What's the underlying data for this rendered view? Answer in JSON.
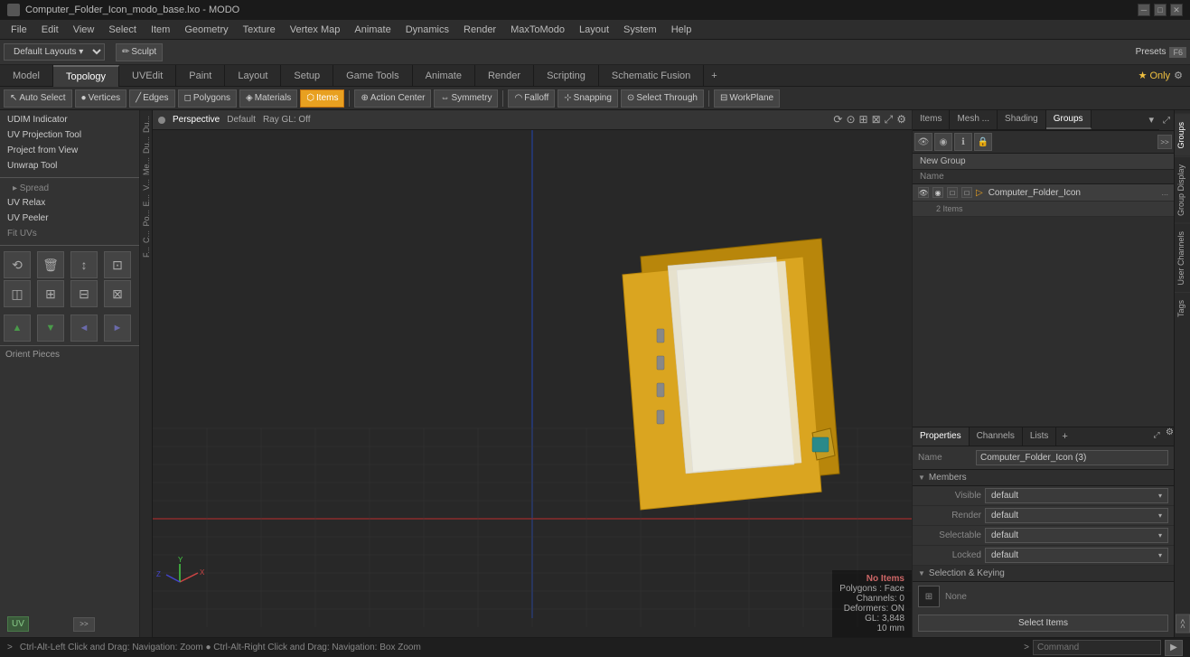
{
  "titlebar": {
    "title": "Computer_Folder_Icon_modo_base.lxo - MODO",
    "icon": "modo-icon",
    "controls": [
      "minimize",
      "maximize",
      "close"
    ]
  },
  "menubar": {
    "items": [
      "File",
      "Edit",
      "View",
      "Select",
      "Item",
      "Geometry",
      "Texture",
      "Vertex Map",
      "Animate",
      "Dynamics",
      "Render",
      "MaxToModo",
      "Layout",
      "System",
      "Help"
    ]
  },
  "toolbar_strip": {
    "default_layouts": "Default Layouts ▾",
    "presets_label": "Presets",
    "presets_key": "F6",
    "sculpt_label": "Sculpt"
  },
  "mode_tabs": {
    "tabs": [
      "Model",
      "Topology",
      "UVEdit",
      "Paint",
      "Layout",
      "Setup",
      "Game Tools",
      "Animate",
      "Render",
      "Scripting",
      "Schematic Fusion"
    ],
    "active": "Topology",
    "add_label": "+",
    "star_only": "★ Only",
    "gear": "⚙"
  },
  "tool_bar": {
    "auto_select": "Auto Select",
    "vertices": "Vertices",
    "edges": "Edges",
    "polygons": "Polygons",
    "materials": "Materials",
    "items": "Items",
    "action_center": "Action Center",
    "symmetry": "Symmetry",
    "falloff": "Falloff",
    "snapping": "Snapping",
    "select_through": "Select Through",
    "workplane": "WorkPlane"
  },
  "left_panel": {
    "tools": [
      "UDIM Indicator",
      "UV Projection Tool",
      "Project from View",
      "Unwrap Tool"
    ],
    "spread": "Spread",
    "uv_relax": "UV Relax",
    "uv_peeler": "UV Peeler",
    "fit_uvs": "Fit UVs",
    "orient_pieces": "Orient Pieces",
    "uv_label": "UV",
    "expand": ">>"
  },
  "viewport": {
    "dot_color": "#888",
    "perspective": "Perspective",
    "default_label": "Default",
    "ray_gl": "Ray GL: Off",
    "no_items": "No Items",
    "polygons": "Polygons : Face",
    "channels": "Channels: 0",
    "deformers": "Deformers: ON",
    "gl": "GL: 3,848",
    "size": "10 mm",
    "status_hint": "Ctrl-Alt-Left Click and Drag: Navigation: Zoom ● Ctrl-Alt-Right Click and Drag: Navigation: Box Zoom"
  },
  "right_panel": {
    "tabs": [
      "Items",
      "Mesh ...",
      "Shading",
      "Groups"
    ],
    "active_tab": "Groups",
    "icon_row": [
      "eye",
      "camera",
      "info",
      "lock"
    ],
    "new_group": "New Group",
    "name_header": "Name",
    "items": [
      {
        "name": "Computer_Folder_Icon",
        "suffix": "...",
        "count": ""
      },
      {
        "name": "2 Items",
        "suffix": "",
        "count": ""
      }
    ],
    "item_name": "Computer_Folder_Icon",
    "item_dots": "..."
  },
  "properties": {
    "tabs": [
      "Properties",
      "Channels",
      "Lists"
    ],
    "active_tab": "Properties",
    "add_label": "+",
    "name_label": "Name",
    "name_value": "Computer_Folder_Icon (3)",
    "members_label": "Members",
    "visible_label": "Visible",
    "visible_value": "default",
    "render_label": "Render",
    "render_value": "default",
    "selectable_label": "Selectable",
    "selectable_value": "default",
    "locked_label": "Locked",
    "locked_value": "default",
    "selection_keying": "Selection & Keying",
    "keying_icon": "⊞",
    "none_label": "None",
    "select_items_label": "Select Items"
  },
  "side_tabs": [
    "Groups",
    "Group Display",
    "User Channels",
    "Tags"
  ],
  "bottom_bar": {
    "status_label": ">",
    "command_placeholder": "Command",
    "run_icon": "▶"
  }
}
